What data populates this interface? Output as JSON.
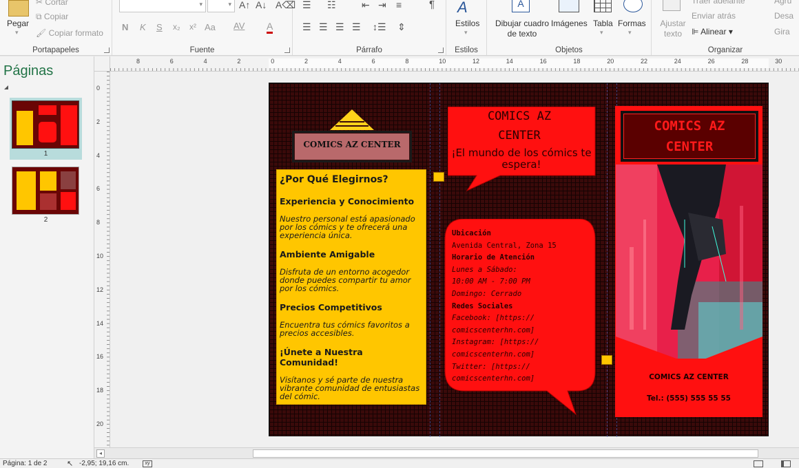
{
  "ribbon": {
    "clipboard": {
      "paste": "Pegar",
      "cut": "Cortar",
      "copy": "Copiar",
      "format_painter": "Copiar formato",
      "label": "Portapapeles"
    },
    "font": {
      "label": "Fuente",
      "bold": "N",
      "italic": "K",
      "underline": "S",
      "subscript": "x₂",
      "superscript": "x²",
      "case": "Aa",
      "spacing": "AV",
      "color": "A"
    },
    "paragraph": {
      "label": "Párrafo",
      "pilcrow": "¶"
    },
    "styles": {
      "label": "Estilos",
      "button": "Estilos"
    },
    "objects": {
      "label": "Objetos",
      "textbox": "Dibujar cuadro de texto",
      "images": "Imágenes",
      "table": "Tabla",
      "shapes": "Formas"
    },
    "arrange": {
      "label": "Organizar",
      "wrap": "Ajustar texto",
      "bring_forward": "Traer adelante",
      "send_back": "Enviar atrás",
      "align": "Alinear",
      "group": "Agru",
      "ungroup": "Desa",
      "rotate": "Gira"
    }
  },
  "pages_pane": {
    "title": "Páginas",
    "thumbs": [
      {
        "num": "1"
      },
      {
        "num": "2"
      }
    ]
  },
  "ruler_top": [
    "8",
    "6",
    "4",
    "2",
    "0",
    "2",
    "4",
    "6",
    "8",
    "10",
    "12",
    "14",
    "16",
    "18",
    "20",
    "22",
    "24",
    "26",
    "28",
    "30"
  ],
  "ruler_left": [
    "0",
    "2",
    "4",
    "6",
    "8",
    "10",
    "12",
    "14",
    "16",
    "18",
    "20"
  ],
  "brochure": {
    "logo_text": "COMICS AZ CENTER",
    "why": {
      "title": "¿Por Qué Elegirnos?",
      "sections": [
        {
          "heading": "Experiencia y Conocimiento",
          "body": "Nuestro personal está apasionado por los cómics y te ofrecerá una experiencia única."
        },
        {
          "heading": "Ambiente Amigable",
          "body": "Disfruta de un entorno acogedor donde puedes compartir tu amor por los cómics."
        },
        {
          "heading": "Precios Competitivos",
          "body": "Encuentra tus cómics favoritos a precios accesibles."
        },
        {
          "heading": "¡Únete a Nuestra Comunidad!",
          "body": "Visítanos y sé parte de nuestra vibrante comunidad de entusiastas del cómic."
        }
      ]
    },
    "bubble1": {
      "title": "COMICS AZ CENTER",
      "subtitle": "¡El mundo de los cómics te espera!"
    },
    "bubble2": {
      "lines": [
        "Ubicación",
        "Avenida Central, Zona 15",
        "Horario de Atención",
        "Lunes a Sábado:",
        "10:00 AM - 7:00 PM",
        "Domingo: Cerrado",
        "Redes Sociales",
        "Facebook: [https://",
        "comicscenterhn.com]",
        "Instagram: [https://",
        "comicscenterhn.com]",
        "Twitter: [https://",
        "comicscenterhn.com]"
      ]
    },
    "cover": {
      "title_line1": "COMICS AZ",
      "title_line2": "CENTER",
      "name": "COMICS AZ CENTER",
      "phone": "Tel.: (555) 555 55 55"
    }
  },
  "status": {
    "page": "Página: 1 de 2",
    "position": "-2,95; 19,16 cm."
  },
  "colors": {
    "brand_red": "#ff1010",
    "yellow": "#ffc600",
    "teal": "#00746c"
  }
}
